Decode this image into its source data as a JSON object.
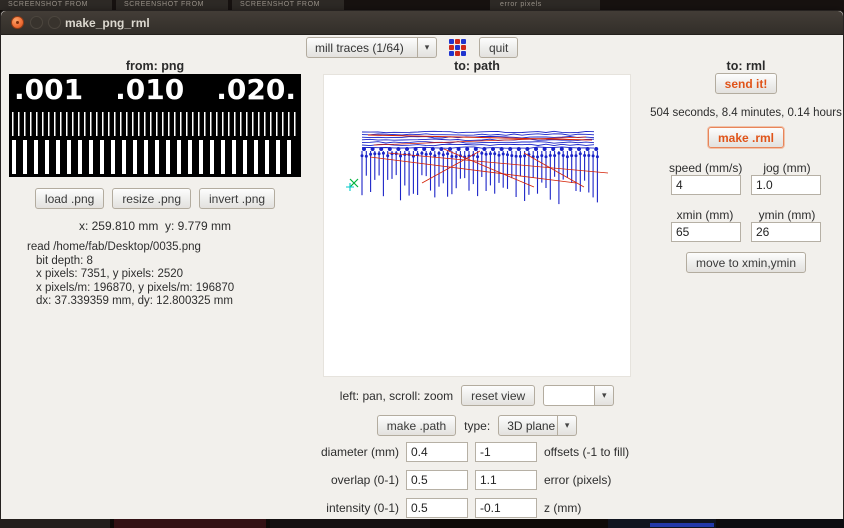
{
  "desktop": {
    "top_fragments": [
      "Screenshot from",
      "Screenshot from",
      "Screenshot from",
      "error pixels"
    ]
  },
  "window": {
    "title": "make_png_rml"
  },
  "icons": {
    "chevron": "▾"
  },
  "toolbar": {
    "mode_value": "mill traces (1/64)",
    "quit_label": "quit"
  },
  "png": {
    "header": "from: png",
    "image_labels": {
      "l1": ".001",
      "l2": ".010",
      "l3": ".020."
    },
    "load_label": "load .png",
    "resize_label": "resize .png",
    "invert_label": "invert .png",
    "coords": "x: 259.810 mm  y: 9.779 mm",
    "info_lines": [
      "read /home/fab/Desktop/0035.png",
      "bit depth: 8",
      "x pixels: 7351, y pixels: 2520",
      "x pixels/m: 196870, y pixels/m: 196870",
      "dx: 37.339359 mm, dy: 12.800325 mm"
    ]
  },
  "path": {
    "header": "to: path",
    "hint": "left: pan, scroll: zoom",
    "reset_label": "reset view",
    "view_select_value": "",
    "make_label": "make .path",
    "type_label": "type:",
    "type_value": "3D plane",
    "rows": [
      {
        "left_label": "diameter (mm)",
        "v1": "0.4",
        "v2": "-1",
        "right_label": "offsets (-1 to fill)"
      },
      {
        "left_label": "overlap (0-1)",
        "v1": "0.5",
        "v2": "1.1",
        "right_label": "error (pixels)"
      },
      {
        "left_label": "intensity (0-1)",
        "v1": "0.5",
        "v2": "-0.1",
        "right_label": "z (mm)"
      }
    ]
  },
  "rml": {
    "header": "to: rml",
    "send_label": "send it!",
    "time_text": "504 seconds, 8.4 minutes, 0.14 hours",
    "make_label": "make .rml",
    "speed_label": "speed (mm/s)",
    "jog_label": "jog (mm)",
    "speed_value": "4",
    "jog_value": "1.0",
    "xmin_label": "xmin (mm)",
    "ymin_label": "ymin (mm)",
    "xmin_value": "65",
    "ymin_value": "26",
    "move_label": "move to xmin,ymin"
  },
  "colors": {
    "accent_orange": "#e0541a",
    "titlebar": "#3a352f",
    "path_blue": "#1b24c8",
    "path_red": "#d42105",
    "origin_green": "#00b43c",
    "origin_cyan": "#00c8c8"
  }
}
